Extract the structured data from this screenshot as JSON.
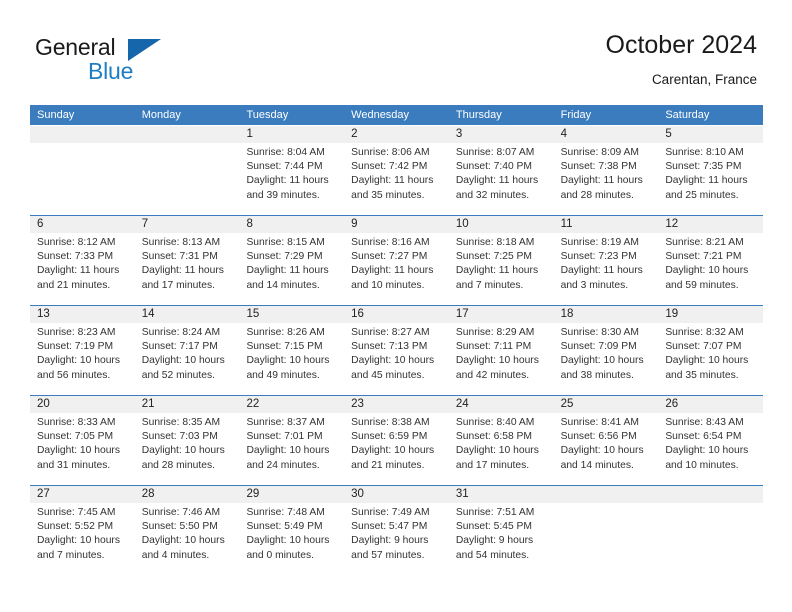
{
  "brand": {
    "name_part1": "General",
    "name_part2": "Blue",
    "triangle_color": "#1566ab",
    "blue_color": "#1f7dc4"
  },
  "header": {
    "title": "October 2024",
    "subtitle": "Carentan, France"
  },
  "theme": {
    "header_blue": "#3a7cbe",
    "day_band_gray": "#f0f0f0",
    "text_color": "#333333"
  },
  "weekdays": [
    "Sunday",
    "Monday",
    "Tuesday",
    "Wednesday",
    "Thursday",
    "Friday",
    "Saturday"
  ],
  "labels": {
    "sunrise": "Sunrise:",
    "sunset": "Sunset:",
    "daylight": "Daylight:"
  },
  "weeks": [
    [
      {
        "day": "",
        "sunrise": "",
        "sunset": "",
        "daylight1": "",
        "daylight2": ""
      },
      {
        "day": "",
        "sunrise": "",
        "sunset": "",
        "daylight1": "",
        "daylight2": ""
      },
      {
        "day": "1",
        "sunrise": "Sunrise: 8:04 AM",
        "sunset": "Sunset: 7:44 PM",
        "daylight1": "Daylight: 11 hours",
        "daylight2": "and 39 minutes."
      },
      {
        "day": "2",
        "sunrise": "Sunrise: 8:06 AM",
        "sunset": "Sunset: 7:42 PM",
        "daylight1": "Daylight: 11 hours",
        "daylight2": "and 35 minutes."
      },
      {
        "day": "3",
        "sunrise": "Sunrise: 8:07 AM",
        "sunset": "Sunset: 7:40 PM",
        "daylight1": "Daylight: 11 hours",
        "daylight2": "and 32 minutes."
      },
      {
        "day": "4",
        "sunrise": "Sunrise: 8:09 AM",
        "sunset": "Sunset: 7:38 PM",
        "daylight1": "Daylight: 11 hours",
        "daylight2": "and 28 minutes."
      },
      {
        "day": "5",
        "sunrise": "Sunrise: 8:10 AM",
        "sunset": "Sunset: 7:35 PM",
        "daylight1": "Daylight: 11 hours",
        "daylight2": "and 25 minutes."
      }
    ],
    [
      {
        "day": "6",
        "sunrise": "Sunrise: 8:12 AM",
        "sunset": "Sunset: 7:33 PM",
        "daylight1": "Daylight: 11 hours",
        "daylight2": "and 21 minutes."
      },
      {
        "day": "7",
        "sunrise": "Sunrise: 8:13 AM",
        "sunset": "Sunset: 7:31 PM",
        "daylight1": "Daylight: 11 hours",
        "daylight2": "and 17 minutes."
      },
      {
        "day": "8",
        "sunrise": "Sunrise: 8:15 AM",
        "sunset": "Sunset: 7:29 PM",
        "daylight1": "Daylight: 11 hours",
        "daylight2": "and 14 minutes."
      },
      {
        "day": "9",
        "sunrise": "Sunrise: 8:16 AM",
        "sunset": "Sunset: 7:27 PM",
        "daylight1": "Daylight: 11 hours",
        "daylight2": "and 10 minutes."
      },
      {
        "day": "10",
        "sunrise": "Sunrise: 8:18 AM",
        "sunset": "Sunset: 7:25 PM",
        "daylight1": "Daylight: 11 hours",
        "daylight2": "and 7 minutes."
      },
      {
        "day": "11",
        "sunrise": "Sunrise: 8:19 AM",
        "sunset": "Sunset: 7:23 PM",
        "daylight1": "Daylight: 11 hours",
        "daylight2": "and 3 minutes."
      },
      {
        "day": "12",
        "sunrise": "Sunrise: 8:21 AM",
        "sunset": "Sunset: 7:21 PM",
        "daylight1": "Daylight: 10 hours",
        "daylight2": "and 59 minutes."
      }
    ],
    [
      {
        "day": "13",
        "sunrise": "Sunrise: 8:23 AM",
        "sunset": "Sunset: 7:19 PM",
        "daylight1": "Daylight: 10 hours",
        "daylight2": "and 56 minutes."
      },
      {
        "day": "14",
        "sunrise": "Sunrise: 8:24 AM",
        "sunset": "Sunset: 7:17 PM",
        "daylight1": "Daylight: 10 hours",
        "daylight2": "and 52 minutes."
      },
      {
        "day": "15",
        "sunrise": "Sunrise: 8:26 AM",
        "sunset": "Sunset: 7:15 PM",
        "daylight1": "Daylight: 10 hours",
        "daylight2": "and 49 minutes."
      },
      {
        "day": "16",
        "sunrise": "Sunrise: 8:27 AM",
        "sunset": "Sunset: 7:13 PM",
        "daylight1": "Daylight: 10 hours",
        "daylight2": "and 45 minutes."
      },
      {
        "day": "17",
        "sunrise": "Sunrise: 8:29 AM",
        "sunset": "Sunset: 7:11 PM",
        "daylight1": "Daylight: 10 hours",
        "daylight2": "and 42 minutes."
      },
      {
        "day": "18",
        "sunrise": "Sunrise: 8:30 AM",
        "sunset": "Sunset: 7:09 PM",
        "daylight1": "Daylight: 10 hours",
        "daylight2": "and 38 minutes."
      },
      {
        "day": "19",
        "sunrise": "Sunrise: 8:32 AM",
        "sunset": "Sunset: 7:07 PM",
        "daylight1": "Daylight: 10 hours",
        "daylight2": "and 35 minutes."
      }
    ],
    [
      {
        "day": "20",
        "sunrise": "Sunrise: 8:33 AM",
        "sunset": "Sunset: 7:05 PM",
        "daylight1": "Daylight: 10 hours",
        "daylight2": "and 31 minutes."
      },
      {
        "day": "21",
        "sunrise": "Sunrise: 8:35 AM",
        "sunset": "Sunset: 7:03 PM",
        "daylight1": "Daylight: 10 hours",
        "daylight2": "and 28 minutes."
      },
      {
        "day": "22",
        "sunrise": "Sunrise: 8:37 AM",
        "sunset": "Sunset: 7:01 PM",
        "daylight1": "Daylight: 10 hours",
        "daylight2": "and 24 minutes."
      },
      {
        "day": "23",
        "sunrise": "Sunrise: 8:38 AM",
        "sunset": "Sunset: 6:59 PM",
        "daylight1": "Daylight: 10 hours",
        "daylight2": "and 21 minutes."
      },
      {
        "day": "24",
        "sunrise": "Sunrise: 8:40 AM",
        "sunset": "Sunset: 6:58 PM",
        "daylight1": "Daylight: 10 hours",
        "daylight2": "and 17 minutes."
      },
      {
        "day": "25",
        "sunrise": "Sunrise: 8:41 AM",
        "sunset": "Sunset: 6:56 PM",
        "daylight1": "Daylight: 10 hours",
        "daylight2": "and 14 minutes."
      },
      {
        "day": "26",
        "sunrise": "Sunrise: 8:43 AM",
        "sunset": "Sunset: 6:54 PM",
        "daylight1": "Daylight: 10 hours",
        "daylight2": "and 10 minutes."
      }
    ],
    [
      {
        "day": "27",
        "sunrise": "Sunrise: 7:45 AM",
        "sunset": "Sunset: 5:52 PM",
        "daylight1": "Daylight: 10 hours",
        "daylight2": "and 7 minutes."
      },
      {
        "day": "28",
        "sunrise": "Sunrise: 7:46 AM",
        "sunset": "Sunset: 5:50 PM",
        "daylight1": "Daylight: 10 hours",
        "daylight2": "and 4 minutes."
      },
      {
        "day": "29",
        "sunrise": "Sunrise: 7:48 AM",
        "sunset": "Sunset: 5:49 PM",
        "daylight1": "Daylight: 10 hours",
        "daylight2": "and 0 minutes."
      },
      {
        "day": "30",
        "sunrise": "Sunrise: 7:49 AM",
        "sunset": "Sunset: 5:47 PM",
        "daylight1": "Daylight: 9 hours",
        "daylight2": "and 57 minutes."
      },
      {
        "day": "31",
        "sunrise": "Sunrise: 7:51 AM",
        "sunset": "Sunset: 5:45 PM",
        "daylight1": "Daylight: 9 hours",
        "daylight2": "and 54 minutes."
      },
      {
        "day": "",
        "sunrise": "",
        "sunset": "",
        "daylight1": "",
        "daylight2": ""
      },
      {
        "day": "",
        "sunrise": "",
        "sunset": "",
        "daylight1": "",
        "daylight2": ""
      }
    ]
  ]
}
